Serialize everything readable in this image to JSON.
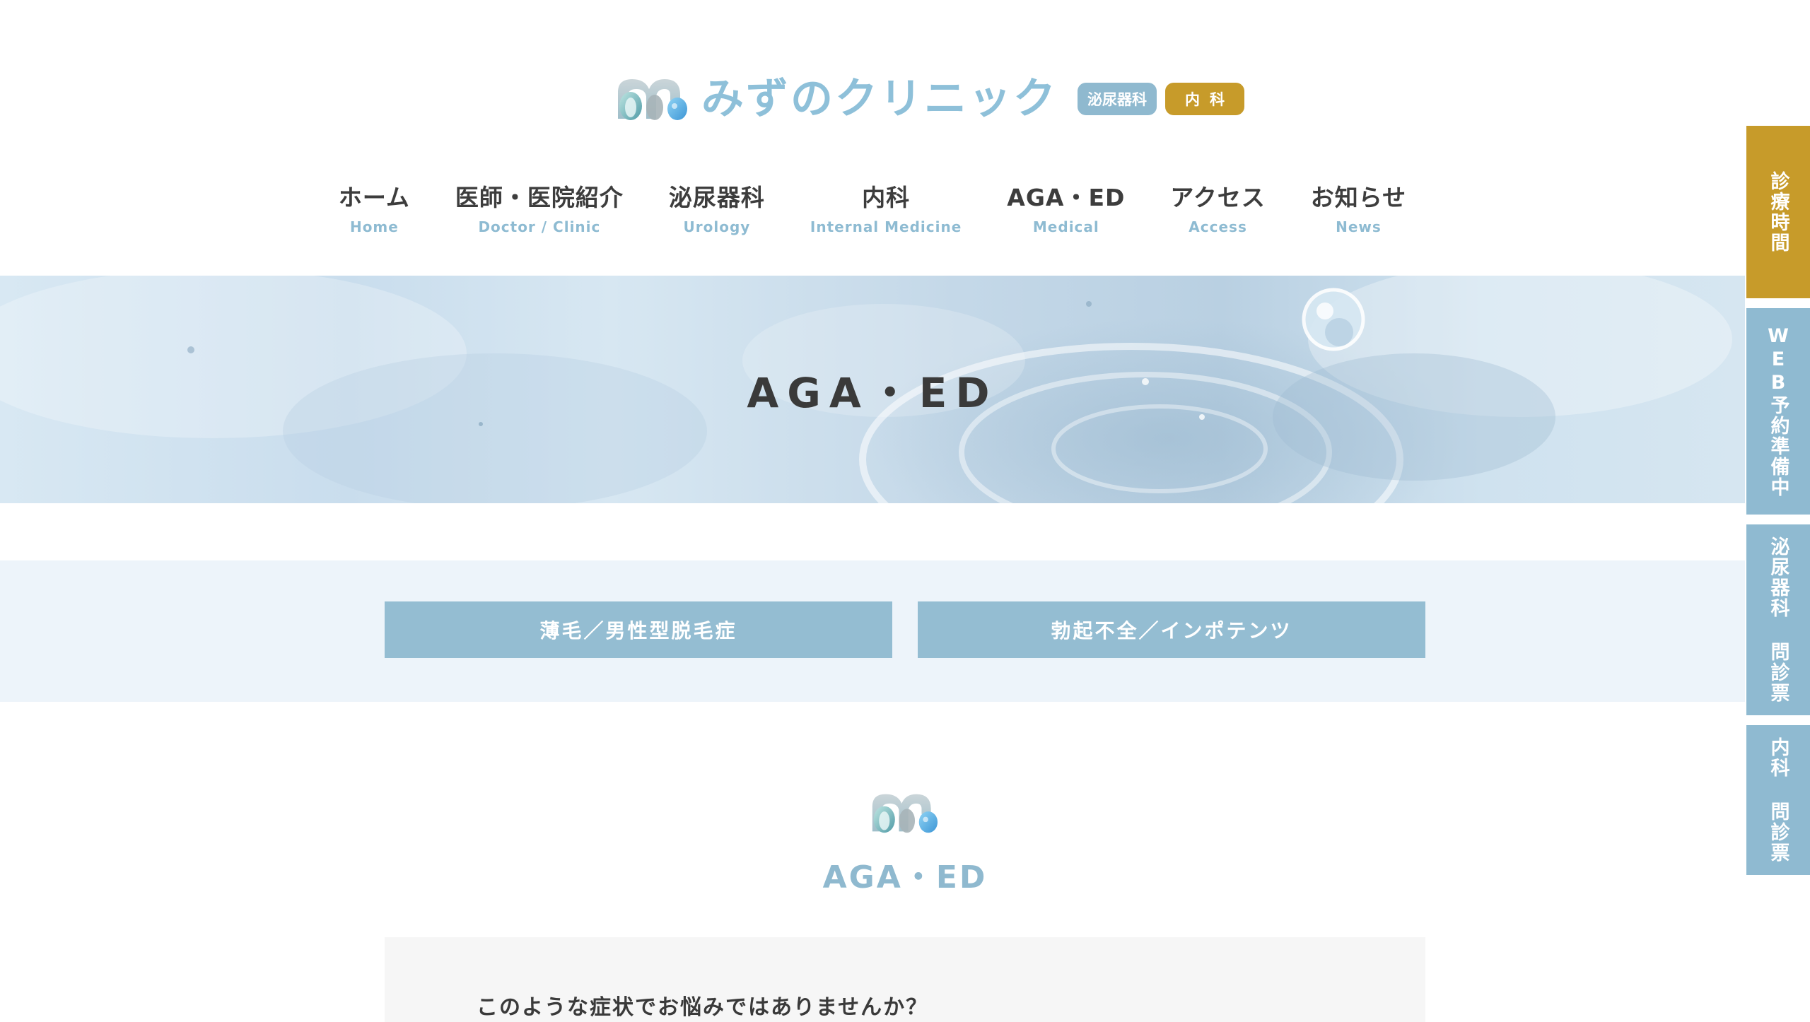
{
  "header": {
    "logo_text": "みずのクリニック",
    "badge_urology": "泌尿器科",
    "badge_internal": "内科"
  },
  "nav": {
    "items": [
      {
        "jp": "ホーム",
        "en": "Home"
      },
      {
        "jp": "医師・医院紹介",
        "en": "Doctor / Clinic"
      },
      {
        "jp": "泌尿器科",
        "en": "Urology"
      },
      {
        "jp": "内科",
        "en": "Internal Medicine"
      },
      {
        "jp": "AGA・ED",
        "en": "Medical"
      },
      {
        "jp": "アクセス",
        "en": "Access"
      },
      {
        "jp": "お知らせ",
        "en": "News"
      }
    ]
  },
  "hero": {
    "title": "AGA・ED"
  },
  "subnav": {
    "buttons": [
      "薄毛／男性型脱毛症",
      "勃起不全／インポテンツ"
    ]
  },
  "section": {
    "title": "AGA・ED",
    "intro_text": "このような症状でお悩みではありませんか？"
  },
  "side_tabs": {
    "hours": "診療時間",
    "web_reservation": "WEB予約準備中",
    "urology_questionnaire": "泌尿器科 問診票",
    "internal_questionnaire": "内科 問診票"
  },
  "colors": {
    "brand_blue": "#8fb9cf",
    "brand_gold": "#c79b2a",
    "band_bg": "#edf4fa"
  }
}
